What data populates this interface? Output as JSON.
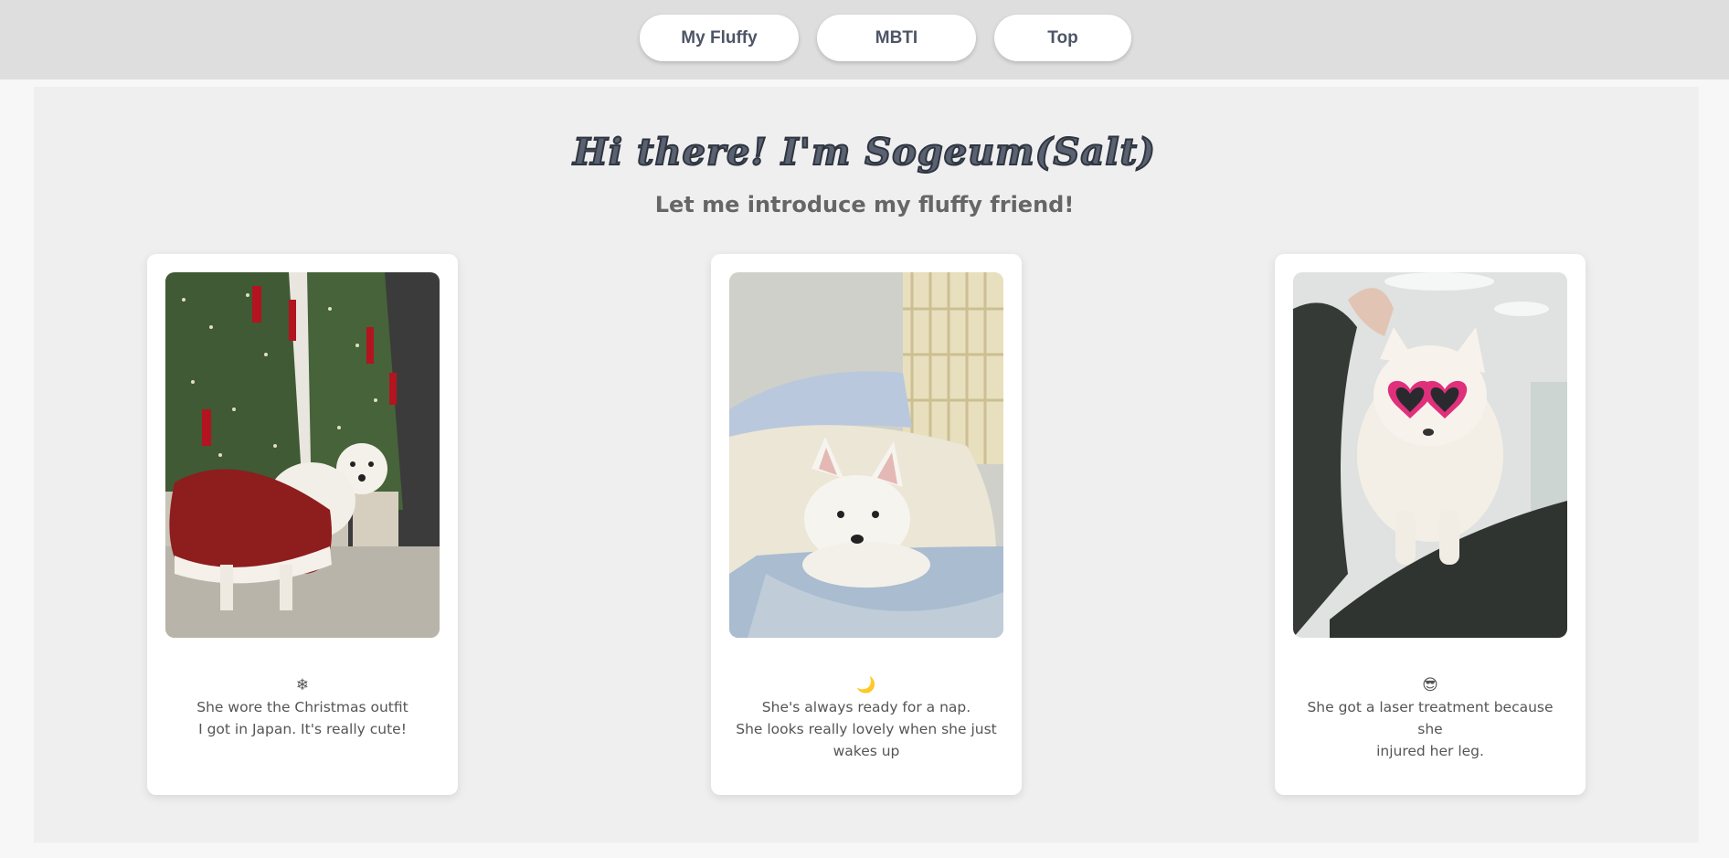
{
  "nav": {
    "my_fluffy": "My Fluffy",
    "mbti": "MBTI",
    "top": "Top"
  },
  "hero": {
    "title": "Hi there! I'm Sogeum(Salt)",
    "subtitle": "Let me introduce my fluffy friend!"
  },
  "cards": [
    {
      "photo_icon": "christmas-dog-photo",
      "emoji": "❄",
      "lines": [
        "She wore the Christmas outfit",
        "I got in Japan. It's really cute!"
      ]
    },
    {
      "photo_icon": "napping-dog-photo",
      "emoji": "🌙",
      "lines": [
        "She's always ready for a nap.",
        "She looks really lovely when she just",
        "wakes up"
      ]
    },
    {
      "photo_icon": "sunglasses-dog-photo",
      "emoji": "😎",
      "lines": [
        "She got a laser treatment because she",
        "injured her leg."
      ]
    }
  ],
  "colors": {
    "topbar": "#dedede",
    "content_bg": "#efefef",
    "card_bg": "#ffffff",
    "title_fill": "#5a6272",
    "nav_text": "#4d5566"
  }
}
